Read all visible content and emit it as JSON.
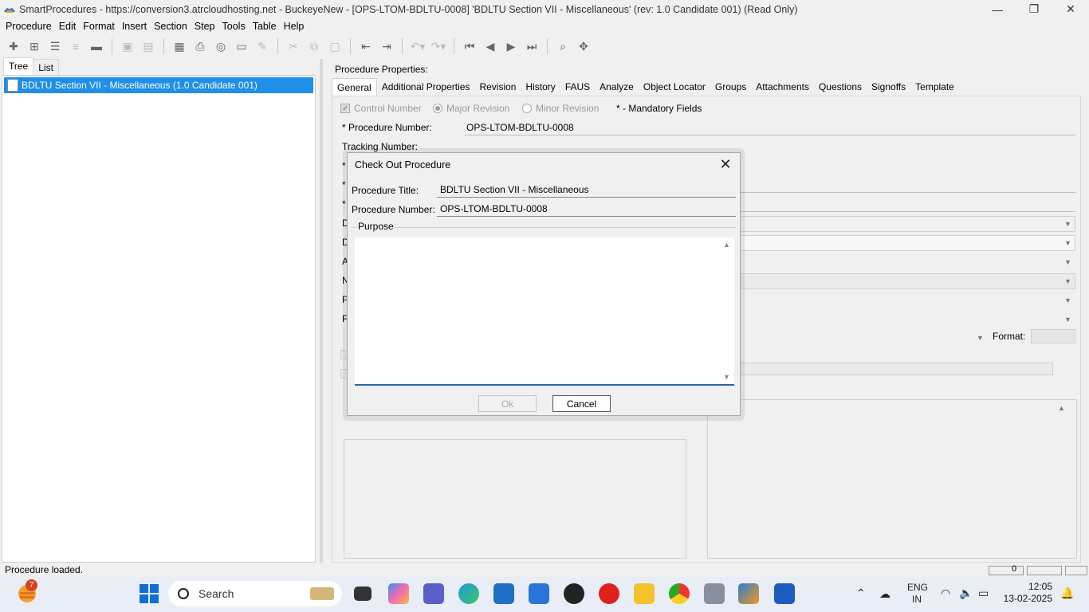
{
  "window": {
    "title": "SmartProcedures - https://conversion3.atrcloudhosting.net - BuckeyeNew - [OPS-LTOM-BDLTU-0008] 'BDLTU Section VII - Miscellaneous' (rev: 1.0 Candidate 001) (Read Only)",
    "minimize": "—",
    "restore": "❐",
    "close": "✕"
  },
  "menu": [
    "Procedure",
    "Edit",
    "Format",
    "Insert",
    "Section",
    "Step",
    "Tools",
    "Table",
    "Help"
  ],
  "left_pane": {
    "tabs": [
      "Tree",
      "List"
    ],
    "tree_item": "BDLTU Section VII - Miscellaneous (1.0 Candidate 001)"
  },
  "properties": {
    "label": "Procedure Properties:",
    "tabs": [
      "General",
      "Additional Properties",
      "Revision",
      "History",
      "FAUS",
      "Analyze",
      "Object Locator",
      "Groups",
      "Attachments",
      "Questions",
      "Signoffs",
      "Template"
    ],
    "control_number": "Control Number",
    "major_revision": "Major Revision",
    "minor_revision": "Minor Revision",
    "mandatory": "* - Mandatory Fields",
    "procedure_number_label": "* Procedure Number:",
    "procedure_number_value": "OPS-LTOM-BDLTU-0008",
    "tracking_number_label": "Tracking Number:",
    "partial_labels": [
      "*",
      "*",
      "*",
      "D",
      "D",
      "A",
      "N",
      "P",
      "F"
    ],
    "format_label": "Format:"
  },
  "status": {
    "text": "Procedure loaded.",
    "box_value": "0"
  },
  "dialog": {
    "title": "Check Out Procedure",
    "close": "✕",
    "title_label": "Procedure Title:",
    "title_value": "BDLTU Section VII - Miscellaneous",
    "number_label": "Procedure Number:",
    "number_value": "OPS-LTOM-BDLTU-0008",
    "purpose_label": "Purpose",
    "purpose_value": "",
    "ok": "Ok",
    "cancel": "Cancel"
  },
  "taskbar": {
    "weather_badge": "7",
    "search": "Search",
    "language": "ENG",
    "region": "IN",
    "time": "12:05",
    "date": "13-02-2025"
  }
}
